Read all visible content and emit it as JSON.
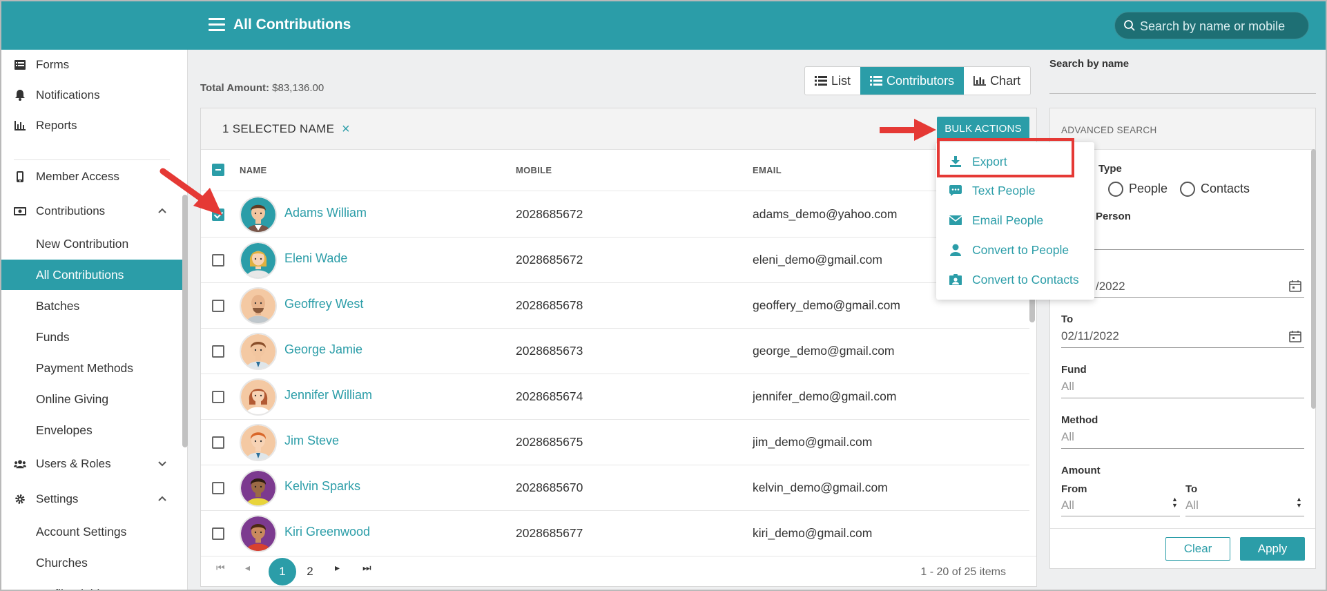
{
  "header": {
    "title": "All Contributions",
    "search_placeholder": "Search by name or mobile"
  },
  "sidebar": {
    "items": [
      {
        "label": "Forms",
        "icon": "list-icon"
      },
      {
        "label": "Notifications",
        "icon": "bell-icon"
      },
      {
        "label": "Reports",
        "icon": "bar-chart-icon"
      },
      {
        "label": "Member Access",
        "icon": "mobile-phone-icon"
      },
      {
        "label": "Contributions",
        "icon": "money-icon",
        "expanded": true
      },
      {
        "label": "Users & Roles",
        "icon": "users-icon",
        "expanded": false
      },
      {
        "label": "Settings",
        "icon": "gear-icon",
        "expanded": true
      }
    ],
    "contributions_sub": [
      "New Contribution",
      "All Contributions",
      "Batches",
      "Funds",
      "Payment Methods",
      "Online Giving",
      "Envelopes"
    ],
    "settings_sub": [
      "Account Settings",
      "Churches",
      "Profile Fields"
    ],
    "active": "All Contributions"
  },
  "summary": {
    "total_label": "Total Amount:",
    "total_value": "$83,136.00"
  },
  "view_toggle": {
    "options": [
      "List",
      "Contributors",
      "Chart"
    ],
    "active": "Contributors"
  },
  "selection": {
    "label": "1 SELECTED NAME",
    "clear_icon": "×",
    "bulk_label": "BULK ACTIONS"
  },
  "bulk_menu": [
    {
      "label": "Export",
      "icon": "download-icon"
    },
    {
      "label": "Text People",
      "icon": "chat-icon"
    },
    {
      "label": "Email People",
      "icon": "envelope-icon"
    },
    {
      "label": "Convert to People",
      "icon": "person-icon"
    },
    {
      "label": "Convert to Contacts",
      "icon": "contact-card-icon"
    }
  ],
  "table": {
    "columns": [
      "NAME",
      "MOBILE",
      "EMAIL"
    ],
    "rows": [
      {
        "name": "Adams William",
        "mobile": "2028685672",
        "email": "adams_demo@yahoo.com",
        "checked": true
      },
      {
        "name": "Eleni Wade",
        "mobile": "2028685672",
        "email": "eleni_demo@gmail.com",
        "checked": false
      },
      {
        "name": "Geoffrey West",
        "mobile": "2028685678",
        "email": "geoffery_demo@gmail.com",
        "checked": false
      },
      {
        "name": "George Jamie",
        "mobile": "2028685673",
        "email": "george_demo@gmail.com",
        "checked": false
      },
      {
        "name": "Jennifer William",
        "mobile": "2028685674",
        "email": "jennifer_demo@gmail.com",
        "checked": false
      },
      {
        "name": "Jim Steve",
        "mobile": "2028685675",
        "email": "jim_demo@gmail.com",
        "checked": false
      },
      {
        "name": "Kelvin Sparks",
        "mobile": "2028685670",
        "email": "kelvin_demo@gmail.com",
        "checked": false
      },
      {
        "name": "Kiri Greenwood",
        "mobile": "2028685677",
        "email": "kiri_demo@gmail.com",
        "checked": false
      }
    ]
  },
  "pagination": {
    "pages": [
      "1",
      "2"
    ],
    "current": "1",
    "info": "1 - 20 of 25 items"
  },
  "filters": {
    "search_by_name_label": "Search by name",
    "panel_title": "ADVANCED SEARCH",
    "type_label": "Type",
    "type_options": [
      "People",
      "Contacts"
    ],
    "person_label": "Person",
    "from_date_tail": "/2022",
    "to_label": "To",
    "to_date": "02/11/2022",
    "fund_label": "Fund",
    "fund_value": "All",
    "method_label": "Method",
    "method_value": "All",
    "amount_label": "Amount",
    "amount_from_label": "From",
    "amount_from_value": "All",
    "amount_to_label": "To",
    "amount_to_value": "All",
    "clear_label": "Clear",
    "apply_label": "Apply"
  },
  "colors": {
    "accent": "#2b9da8",
    "highlight": "#e53935"
  }
}
